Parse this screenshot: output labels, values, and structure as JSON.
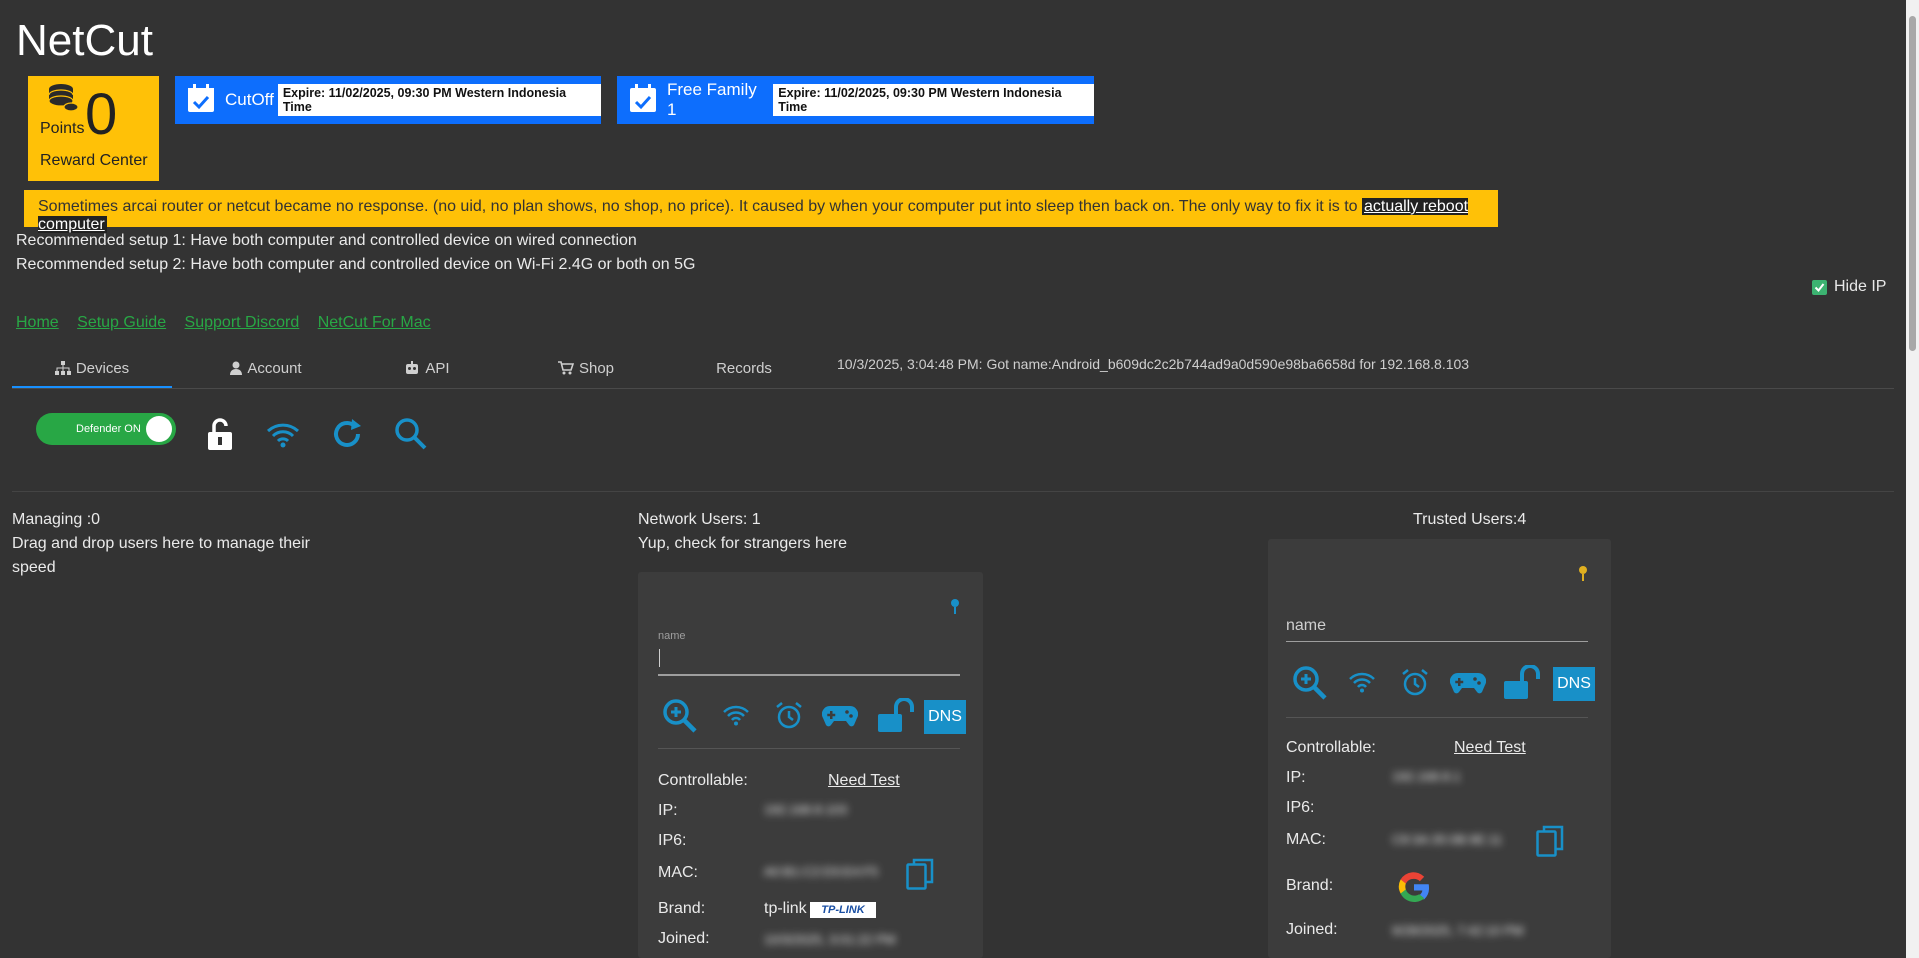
{
  "app": {
    "title": "NetCut"
  },
  "points": {
    "label": "Points",
    "value": "0",
    "reward_label": "Reward Center"
  },
  "plans": [
    {
      "name": "CutOff",
      "expire": "Expire: 11/02/2025, 09:30 PM Western Indonesia Time"
    },
    {
      "name": "Free Family 1",
      "expire": "Expire: 11/02/2025, 09:30 PM Western Indonesia Time"
    }
  ],
  "warning": {
    "text": "Sometimes arcai router or netcut became no response. (no uid, no plan shows, no shop, no price). It caused by when your computer put into sleep then back on. The only way to fix it is to ",
    "link": "actually reboot computer "
  },
  "recommendations": [
    "Recommended setup 1: Have both computer and controlled device on wired connection",
    "Recommended setup 2: Have both computer and controlled device on Wi-Fi 2.4G or both on 5G"
  ],
  "hide_ip": {
    "label": "Hide IP",
    "checked": true
  },
  "nav_links": [
    "Home",
    "Setup Guide",
    "Support Discord",
    "NetCut For Mac"
  ],
  "tabs": [
    "Devices",
    "Account",
    "API",
    "Shop",
    "Records"
  ],
  "status_message": "10/3/2025, 3:04:48 PM: Got name:Android_b609dc2c2b744ad9a0d590e98ba6658d for 192.168.8.103",
  "toolbar": {
    "defender_label": "Defender ON",
    "icons": [
      "unlock-icon",
      "wifi-icon",
      "refresh-icon",
      "search-icon"
    ]
  },
  "columns": {
    "managing": {
      "title": "Managing :0",
      "desc_1": "Drag and drop users here to manage their",
      "desc_2": "speed"
    },
    "network": {
      "title": "Network Users: 1",
      "desc": "Yup, check for strangers here"
    },
    "trusted": {
      "title": "Trusted Users:4"
    }
  },
  "network_card": {
    "name_label": "name",
    "name_value": "",
    "dns_label": "DNS",
    "controllable_label": "Controllable:",
    "controllable_value": "Need Test",
    "ip_label": "IP:",
    "ip_value": "192.168.8.103",
    "ip6_label": "IP6:",
    "mac_label": "MAC:",
    "mac_value": "A0:B1:C2:D3:E4:F5",
    "brand_label": "Brand:",
    "brand_value": "tp-link",
    "brand_logo": "TP-LINK",
    "joined_label": "Joined:",
    "joined_value": "10/3/2025, 3:01:22 PM"
  },
  "trusted_card": {
    "name_placeholder": "name",
    "dns_label": "DNS",
    "controllable_label": "Controllable:",
    "controllable_value": "Need Test",
    "ip_label": "IP:",
    "ip_value": "192.168.8.1",
    "ip6_label": "IP6:",
    "mac_label": "MAC:",
    "mac_value": "C8:3A:35:0B:9E:11",
    "brand_label": "Brand:",
    "joined_label": "Joined:",
    "joined_value": "9/28/2025, 7:42:10 PM"
  },
  "colors": {
    "background": "#333333",
    "accent_blue": "#1890c8",
    "yellow": "#ffc107",
    "plan_blue": "#0d6efd",
    "green": "#28a745"
  }
}
